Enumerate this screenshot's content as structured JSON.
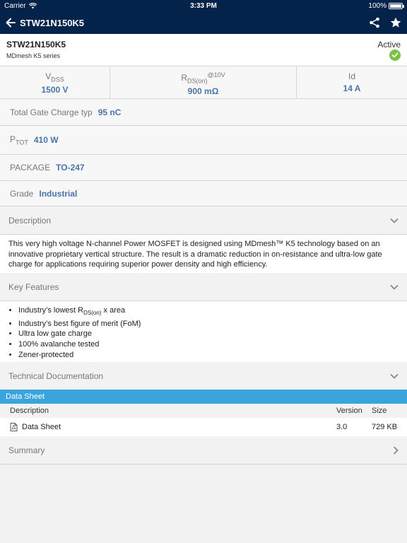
{
  "status_bar": {
    "carrier": "Carrier",
    "time": "3:33 PM",
    "battery": "100%"
  },
  "nav": {
    "title": "STW21N150K5"
  },
  "header": {
    "part_number": "STW21N150K5",
    "series": "MDmesh K5 series",
    "status": "Active"
  },
  "params": [
    {
      "label_main": "V",
      "label_sub": "DSS",
      "label_sup": "",
      "value": "1500 V"
    },
    {
      "label_main": "R",
      "label_sub": "DS(on)",
      "label_sup": "@10V",
      "value": "900 mΩ"
    },
    {
      "label_main": "Id",
      "label_sub": "",
      "label_sup": "",
      "value": "14 A"
    }
  ],
  "specs": {
    "gate_charge": {
      "label": "Total Gate Charge typ",
      "value": "95 nC"
    },
    "ptot": {
      "label_main": "P",
      "label_sub": "TOT",
      "value": "410 W"
    },
    "package": {
      "label": "PACKAGE",
      "value": "TO-247"
    },
    "grade": {
      "label": "Grade",
      "value": "Industrial"
    }
  },
  "description": {
    "title": "Description",
    "text": "This very high voltage N-channel Power MOSFET is designed using MDmesh™ K5 technology based on an innovative proprietary vertical structure. The result is a dramatic reduction in on-resistance and ultra-low gate charge for applications requiring superior power density and high efficiency."
  },
  "key_features": {
    "title": "Key Features",
    "first_item": {
      "before": "Industry’s lowest R",
      "sub": "DS(on)",
      "after": " x area"
    },
    "items": [
      "Industry’s best figure of merit (FoM)",
      "Ultra low gate charge",
      "100% avalanche tested",
      "Zener-protected"
    ]
  },
  "tech_docs": {
    "title": "Technical Documentation",
    "category": "Data Sheet",
    "columns": {
      "description": "Description",
      "version": "Version",
      "size": "Size"
    },
    "rows": [
      {
        "description": "Data Sheet",
        "version": "3.0",
        "size": "729 KB"
      }
    ]
  },
  "summary": {
    "title": "Summary"
  },
  "icons": {
    "back": "arrow-left-icon",
    "share": "share-icon",
    "favorite": "star-icon",
    "status": "check-circle-icon",
    "chevron": "chevron-down-icon",
    "pdf": "pdf-icon"
  },
  "colors": {
    "nav_bg": "#03234b",
    "value_blue": "#4a74a8",
    "active_green": "#7cc242",
    "datasheet_bar": "#3aa5dc"
  }
}
